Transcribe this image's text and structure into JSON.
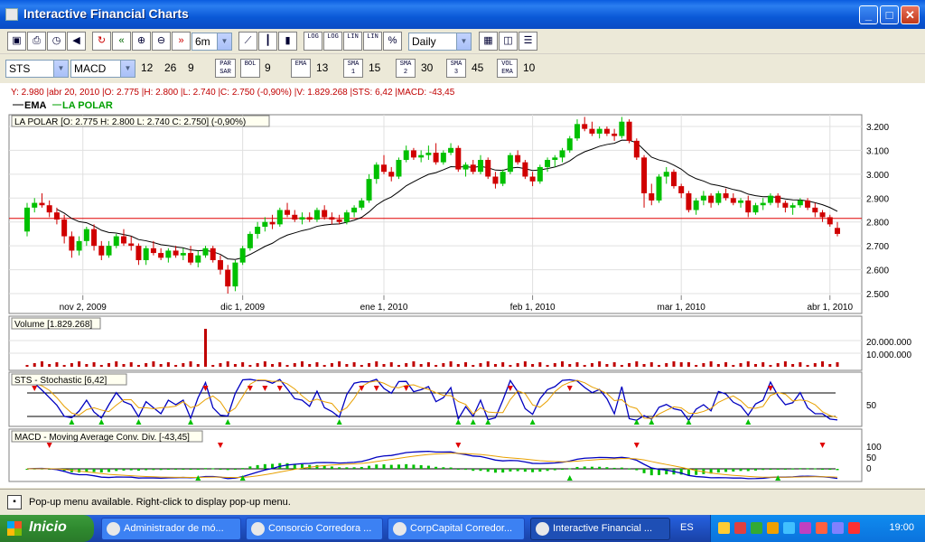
{
  "window": {
    "title": "Interactive Financial Charts",
    "controls": [
      "_",
      "□",
      "✕"
    ]
  },
  "toolbar1": {
    "period_value": "6m",
    "interval_value": "Daily",
    "log1": "LOG",
    "log2": "LOG",
    "lin1": "LIN",
    "lin2": "LIN",
    "pct": "%"
  },
  "toolbar2": {
    "symbol": "STS",
    "indicator": "MACD",
    "p1": "12",
    "p2": "26",
    "p3": "9",
    "par_sar": "PAR SAR",
    "bol": "BOL",
    "bol_val": "9",
    "ema": "EMA",
    "ema_val": "13",
    "sma1": "SMA 1",
    "sma1_val": "15",
    "sma2": "SMA 2",
    "sma2_val": "30",
    "sma3": "SMA 3",
    "sma3_val": "45",
    "vol_ema": "VOL EMA",
    "vol_ema_val": "10"
  },
  "info_line": "Y: 2.980 |abr 20, 2010 |O: 2.775 |H: 2.800 |L: 2.740 |C: 2.750 (-0,90%) |V: 1.829.268 |STS: 6,42 |MACD: -43,45",
  "legend": {
    "ema": "EMA",
    "series": "LA POLAR"
  },
  "price_panel": {
    "header": "LA POLAR [O: 2.775  H: 2.800  L: 2.740  C: 2.750] (-0,90%)",
    "y_ticks": [
      "3.200",
      "3.100",
      "3.000",
      "2.900",
      "2.800",
      "2.700",
      "2.600",
      "2.500"
    ],
    "x_ticks": [
      "nov 2, 2009",
      "dic 1, 2009",
      "ene 1, 2010",
      "feb 1, 2010",
      "mar 1, 2010",
      "abr 1, 2010"
    ]
  },
  "volume_panel": {
    "header": "Volume [1.829.268]",
    "y_ticks": [
      "20.000.000",
      "10.000.000"
    ]
  },
  "stoch_panel": {
    "header": "STS - Stochastic [6,42]",
    "y_ticks": [
      "50"
    ]
  },
  "macd_panel": {
    "header": "MACD - Moving Average Conv. Div. [-43,45]",
    "y_ticks": [
      "100",
      "50",
      "0"
    ]
  },
  "status": {
    "text": "Pop-up menu available. Right-click to display pop-up menu."
  },
  "taskbar": {
    "start": "Inicio",
    "tasks": [
      "Administrador de mó...",
      "Consorcio Corredora ...",
      "CorpCapital Corredor...",
      "Interactive Financial ..."
    ],
    "lang": "ES",
    "clock": "19:00"
  },
  "colors": {
    "up": "#00c000",
    "down": "#d00000",
    "ema": "#000000",
    "signal": "#e8a000",
    "stoch": "#0000c0"
  },
  "chart_data": {
    "type": "candlestick",
    "series": "LA POLAR",
    "ylim": [
      2480,
      3260
    ],
    "ohlc": [
      [
        2760,
        2880,
        2740,
        2860
      ],
      [
        2860,
        2900,
        2840,
        2880
      ],
      [
        2880,
        2920,
        2860,
        2870
      ],
      [
        2870,
        2890,
        2820,
        2840
      ],
      [
        2840,
        2860,
        2790,
        2810
      ],
      [
        2810,
        2830,
        2710,
        2740
      ],
      [
        2740,
        2760,
        2650,
        2680
      ],
      [
        2680,
        2740,
        2660,
        2720
      ],
      [
        2720,
        2780,
        2700,
        2770
      ],
      [
        2770,
        2790,
        2680,
        2700
      ],
      [
        2700,
        2720,
        2640,
        2660
      ],
      [
        2660,
        2720,
        2650,
        2700
      ],
      [
        2700,
        2750,
        2690,
        2740
      ],
      [
        2740,
        2770,
        2700,
        2710
      ],
      [
        2710,
        2740,
        2680,
        2700
      ],
      [
        2700,
        2710,
        2620,
        2640
      ],
      [
        2640,
        2700,
        2620,
        2690
      ],
      [
        2690,
        2720,
        2660,
        2670
      ],
      [
        2670,
        2690,
        2640,
        2650
      ],
      [
        2650,
        2690,
        2630,
        2680
      ],
      [
        2680,
        2700,
        2650,
        2660
      ],
      [
        2660,
        2690,
        2640,
        2670
      ],
      [
        2670,
        2700,
        2620,
        2630
      ],
      [
        2630,
        2680,
        2610,
        2660
      ],
      [
        2660,
        2700,
        2650,
        2690
      ],
      [
        2690,
        2700,
        2630,
        2640
      ],
      [
        2640,
        2660,
        2580,
        2600
      ],
      [
        2600,
        2620,
        2500,
        2530
      ],
      [
        2530,
        2640,
        2510,
        2630
      ],
      [
        2630,
        2700,
        2620,
        2690
      ],
      [
        2690,
        2760,
        2680,
        2750
      ],
      [
        2750,
        2800,
        2730,
        2780
      ],
      [
        2780,
        2820,
        2760,
        2800
      ],
      [
        2800,
        2830,
        2770,
        2790
      ],
      [
        2790,
        2860,
        2780,
        2850
      ],
      [
        2850,
        2880,
        2820,
        2830
      ],
      [
        2830,
        2850,
        2800,
        2810
      ],
      [
        2810,
        2840,
        2790,
        2820
      ],
      [
        2820,
        2840,
        2800,
        2810
      ],
      [
        2810,
        2860,
        2800,
        2850
      ],
      [
        2850,
        2870,
        2810,
        2820
      ],
      [
        2820,
        2840,
        2790,
        2810
      ],
      [
        2810,
        2830,
        2790,
        2800
      ],
      [
        2800,
        2850,
        2790,
        2840
      ],
      [
        2840,
        2870,
        2820,
        2860
      ],
      [
        2860,
        2900,
        2850,
        2890
      ],
      [
        2890,
        3000,
        2880,
        2980
      ],
      [
        2980,
        3050,
        2960,
        3040
      ],
      [
        3040,
        3080,
        3000,
        3010
      ],
      [
        3010,
        3030,
        2970,
        2990
      ],
      [
        2990,
        3070,
        2980,
        3060
      ],
      [
        3060,
        3120,
        3050,
        3100
      ],
      [
        3100,
        3110,
        3060,
        3070
      ],
      [
        3070,
        3100,
        3050,
        3080
      ],
      [
        3080,
        3120,
        3060,
        3090
      ],
      [
        3090,
        3130,
        3040,
        3050
      ],
      [
        3050,
        3100,
        3040,
        3090
      ],
      [
        3090,
        3130,
        3080,
        3110
      ],
      [
        3110,
        3120,
        3010,
        3020
      ],
      [
        3020,
        3050,
        2990,
        3040
      ],
      [
        3040,
        3060,
        3000,
        3010
      ],
      [
        3010,
        3080,
        3000,
        3060
      ],
      [
        3060,
        3070,
        2980,
        2990
      ],
      [
        2990,
        3010,
        2940,
        2960
      ],
      [
        2960,
        3020,
        2950,
        3010
      ],
      [
        3010,
        3090,
        3000,
        3080
      ],
      [
        3080,
        3100,
        3040,
        3050
      ],
      [
        3050,
        3060,
        2980,
        2990
      ],
      [
        2990,
        3010,
        2950,
        2970
      ],
      [
        2970,
        3040,
        2960,
        3030
      ],
      [
        3030,
        3070,
        3010,
        3060
      ],
      [
        3060,
        3080,
        3030,
        3070
      ],
      [
        3070,
        3110,
        3050,
        3100
      ],
      [
        3100,
        3160,
        3090,
        3150
      ],
      [
        3150,
        3230,
        3140,
        3210
      ],
      [
        3210,
        3240,
        3180,
        3190
      ],
      [
        3190,
        3220,
        3160,
        3170
      ],
      [
        3170,
        3200,
        3150,
        3190
      ],
      [
        3190,
        3200,
        3160,
        3170
      ],
      [
        3170,
        3190,
        3140,
        3160
      ],
      [
        3160,
        3240,
        3150,
        3220
      ],
      [
        3220,
        3230,
        3130,
        3140
      ],
      [
        3140,
        3150,
        3060,
        3070
      ],
      [
        3070,
        3080,
        2860,
        2920
      ],
      [
        2920,
        2960,
        2870,
        2890
      ],
      [
        2890,
        3000,
        2880,
        2990
      ],
      [
        2990,
        3030,
        2960,
        3010
      ],
      [
        3010,
        3020,
        2940,
        2950
      ],
      [
        2950,
        2960,
        2900,
        2920
      ],
      [
        2920,
        2930,
        2840,
        2850
      ],
      [
        2850,
        2900,
        2830,
        2890
      ],
      [
        2890,
        2930,
        2870,
        2910
      ],
      [
        2910,
        2920,
        2860,
        2880
      ],
      [
        2880,
        2930,
        2870,
        2920
      ],
      [
        2920,
        2940,
        2890,
        2900
      ],
      [
        2900,
        2920,
        2870,
        2880
      ],
      [
        2880,
        2900,
        2860,
        2890
      ],
      [
        2890,
        2910,
        2820,
        2840
      ],
      [
        2840,
        2880,
        2830,
        2870
      ],
      [
        2870,
        2900,
        2850,
        2880
      ],
      [
        2880,
        2920,
        2870,
        2910
      ],
      [
        2910,
        2920,
        2860,
        2880
      ],
      [
        2880,
        2890,
        2840,
        2860
      ],
      [
        2860,
        2880,
        2830,
        2870
      ],
      [
        2870,
        2900,
        2860,
        2890
      ],
      [
        2890,
        2900,
        2850,
        2860
      ],
      [
        2860,
        2880,
        2820,
        2840
      ],
      [
        2840,
        2850,
        2800,
        2820
      ],
      [
        2820,
        2830,
        2780,
        2790
      ],
      [
        2775,
        2800,
        2740,
        2750
      ]
    ],
    "hline": 2815
  }
}
